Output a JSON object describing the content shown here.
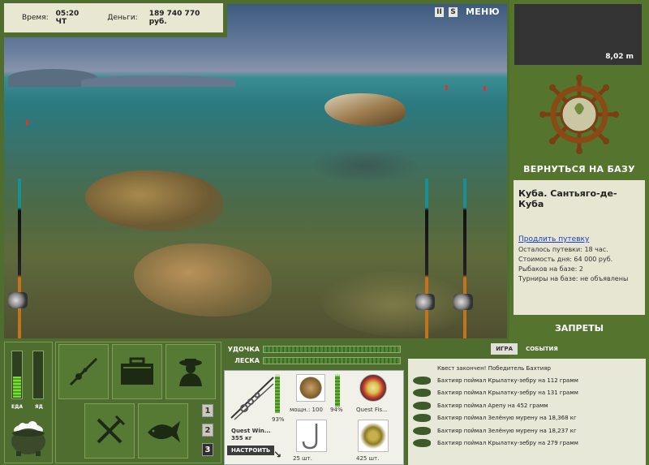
{
  "hud": {
    "time_label": "Время:",
    "time_value": "05:20 ЧТ",
    "money_label": "Деньги:",
    "money_value": "189 740 770 руб."
  },
  "topbar": {
    "pause_label": "II",
    "sound_label": "S",
    "menu_label": "МЕНЮ"
  },
  "depth": {
    "value": "8,02 m"
  },
  "base": {
    "return_label": "ВЕРНУТЬСЯ НА БАЗУ",
    "location": "Куба. Сантьяго-де-Куба",
    "extend_link": "Продлить путевку",
    "lines": [
      "Осталось путевки: 18 час.",
      "Стоимость дня: 64 000 руб.",
      "Рыбаков на базе: 2",
      "Турниры на базе: не объявлены"
    ],
    "bans_label": "ЗАПРЕТЫ"
  },
  "status": {
    "food_label": "ЕДА",
    "poison_label": "ЯД",
    "food_level": 0.45,
    "poison_level": 0.0
  },
  "rod_numbers": [
    "1",
    "2",
    "3"
  ],
  "rod_selected": 2,
  "tackle": {
    "rod_label": "УДОЧКА",
    "line_label": "ЛЕСКА",
    "rod_name": "Quest Win...",
    "rod_weight": "355 кг",
    "rod_percent": "93%",
    "reel_power": "мощн.: 100",
    "reel_percent": "94%",
    "line_name": "Quest Fis...",
    "hooks_count": "25 шт.",
    "bait_count": "425 шт.",
    "setup_label": "НАСТРОИТЬ"
  },
  "events": {
    "tab_game": "ИГРА",
    "tab_events": "СОБЫТИЯ",
    "quest_done": "Квест закончен! Победитель Бахтияр",
    "items": [
      "Бахтияр поймал Крылатку-зебру на 112 грамм",
      "Бахтияр поймал Крылатку-зебру на 131 грамм",
      "Бахтияр поймал Арепу на 452 грамм",
      "Бахтияр поймал Зелёную мурену на 18,368 кг",
      "Бахтияр поймал Зелёную мурену на 18,237 кг",
      "Бахтияр поймал Крылатку-зебру на 279 грамм"
    ]
  }
}
